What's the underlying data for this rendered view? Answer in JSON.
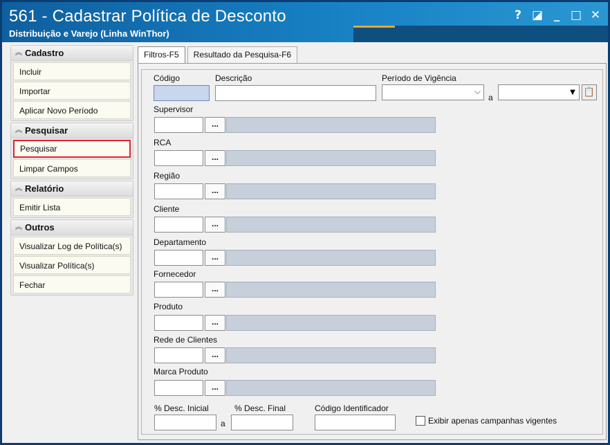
{
  "window": {
    "title": "561 - Cadastrar Política de Desconto",
    "subtitle": "Distribuição e Varejo (Linha WinThor)",
    "controls": {
      "help": "?",
      "restore": "◪",
      "minimize": "_",
      "maximize": "□",
      "close": "✕"
    }
  },
  "sidebar": {
    "sections": [
      {
        "header": "Cadastro",
        "items": [
          "Incluir",
          "Importar",
          "Aplicar Novo Período"
        ]
      },
      {
        "header": "Pesquisar",
        "items": [
          "Pesquisar",
          "Limpar Campos"
        ]
      },
      {
        "header": "Relatório",
        "items": [
          "Emitir Lista"
        ]
      },
      {
        "header": "Outros",
        "items": [
          "Visualizar Log de Política(s)",
          "Visualizar Política(s)",
          "Fechar"
        ]
      }
    ]
  },
  "tabs": [
    "Filtros-F5",
    "Resultado da Pesquisa-F6"
  ],
  "form": {
    "codigo_label": "Código",
    "descricao_label": "Descrição",
    "periodo_label": "Período de Vigência",
    "periodo_sep": "a",
    "lookups": [
      "Supervisor",
      "RCA",
      "Região",
      "Cliente",
      "Departamento",
      "Fornecedor",
      "Produto",
      "Rede de Clientes",
      "Marca Produto"
    ],
    "dots": "...",
    "desc_inicial_label": "% Desc. Inicial",
    "desc_sep": "a",
    "desc_final_label": "% Desc. Final",
    "codigo_ident_label": "Código Identificador",
    "checkbox_label": "Exibir apenas campanhas vigentes"
  },
  "colors": {
    "title_bar": "#1781c4",
    "active_highlight": "#e0252f",
    "focused_field": "#c8d6ee",
    "readonly_field": "#c7d0da"
  }
}
